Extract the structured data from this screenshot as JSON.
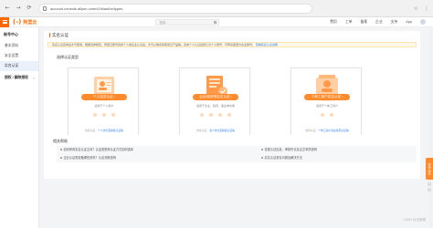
{
  "browser": {
    "back_glyph": "←",
    "forward_glyph": "→",
    "reload_glyph": "⟳",
    "url": "account.console.aliyun.com/v2/#/authc/types",
    "extras": [
      "☆",
      "⋮"
    ]
  },
  "topbar": {
    "logo_mark": "(-)",
    "logo_text": "阿里云",
    "search_placeholder": "搜索...",
    "links": [
      "费用",
      "工单",
      "备案",
      "企业",
      "支持",
      "App"
    ]
  },
  "sidebar": {
    "title": "账号中心",
    "items": [
      {
        "label": "基本资料",
        "active": false
      },
      {
        "label": "安全设置",
        "active": false
      },
      {
        "label": "实名认证",
        "active": true
      },
      {
        "label": "授权 / 解除授权",
        "active": false,
        "group": true
      }
    ],
    "chevron": "›"
  },
  "main": {
    "panel_title": "实名认证",
    "notice": "实名认证完成后才可使用，根据法律规定，阿里云账号完成个人或企业认证后，才可以购买和使用云产品等。完成个人认证后默认为个人账号，可申请变更为企业账号。",
    "notice_link": "查看实名认证说明",
    "section_label": "选择认证类型",
    "cards": [
      {
        "cta": "个人实名认证 ›",
        "sub": "适用于个人用户",
        "foot_text": "支持认证：",
        "foot_link": "个人支付宝授权认证等"
      },
      {
        "cta": "企业/政府等实名认证 ›",
        "sub": "适用于企业、政府、事业单位等",
        "foot_text": "支持认证：",
        "foot_link": "法人支付宝授权认证等"
      },
      {
        "cta": "个体工商户实名认证 ›",
        "sub": "适用于个体工商户",
        "foot_text": "支持认证：",
        "foot_link": "个体工商户营业执照认证等"
      }
    ],
    "faq_title": "相关帮助",
    "faqs": [
      "如何修改实名认证主体？认证类型和认证方式如何选择",
      "企业认证需准备哪些资料？认证流程说明",
      "变更认证信息，审核时长及注意事项说明",
      "实名认证常见问题及解决方法"
    ]
  },
  "float_tab": "咨询·建议",
  "watermark": "CSDN @无赖猴"
}
